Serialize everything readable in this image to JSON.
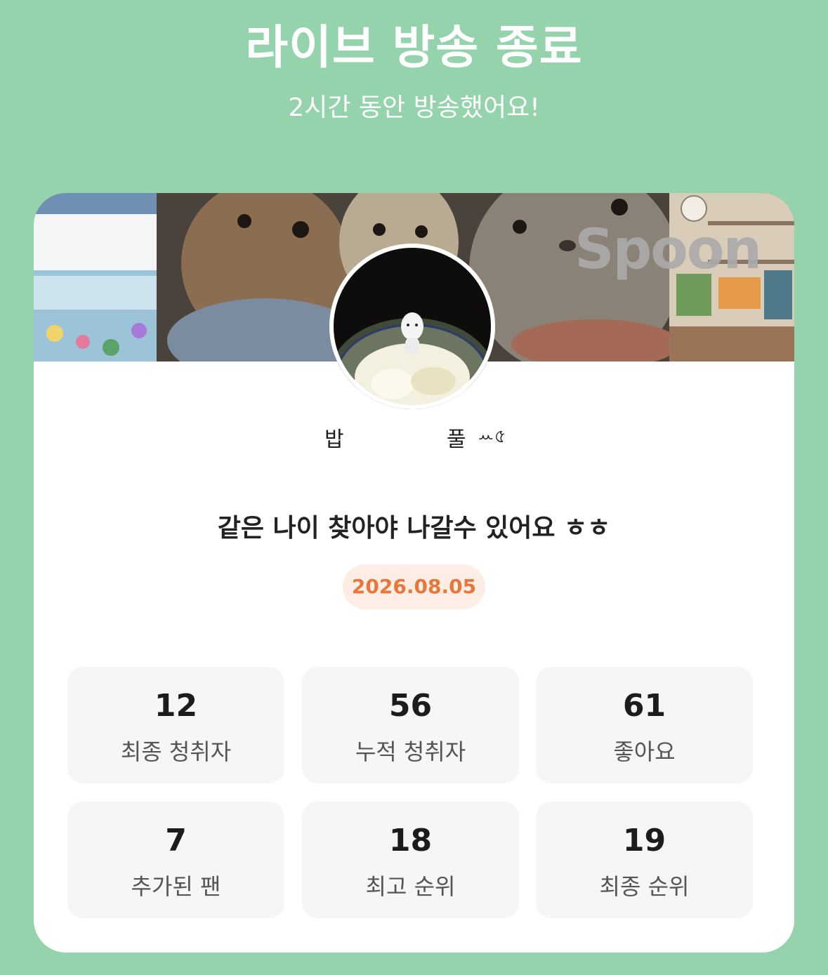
{
  "header": {
    "title": "라이브 방송 종료",
    "subtitle": "2시간 동안 방송했어요!"
  },
  "banner": {
    "watermark": "Spoon",
    "image": "cover-photo"
  },
  "profile": {
    "avatar": "avatar-photo",
    "nickname_part1": "밥",
    "nickname_part2": "풀",
    "nickname_part3": "ꕀ৫"
  },
  "room": {
    "title": "같은 나이 찾아야 나갈수 있어요 ㅎㅎ",
    "date": "2026.08.05"
  },
  "stats": [
    {
      "value": "12",
      "label": "최종 청취자"
    },
    {
      "value": "56",
      "label": "누적 청취자"
    },
    {
      "value": "61",
      "label": "좋아요"
    },
    {
      "value": "7",
      "label": "추가된 팬"
    },
    {
      "value": "18",
      "label": "최고 순위"
    },
    {
      "value": "19",
      "label": "최종 순위"
    }
  ],
  "colors": {
    "background": "#94d3ab",
    "card": "#ffffff",
    "date_text": "#e8773d",
    "date_bg": "#fdeee5",
    "stat_bg": "#f6f6f6"
  }
}
